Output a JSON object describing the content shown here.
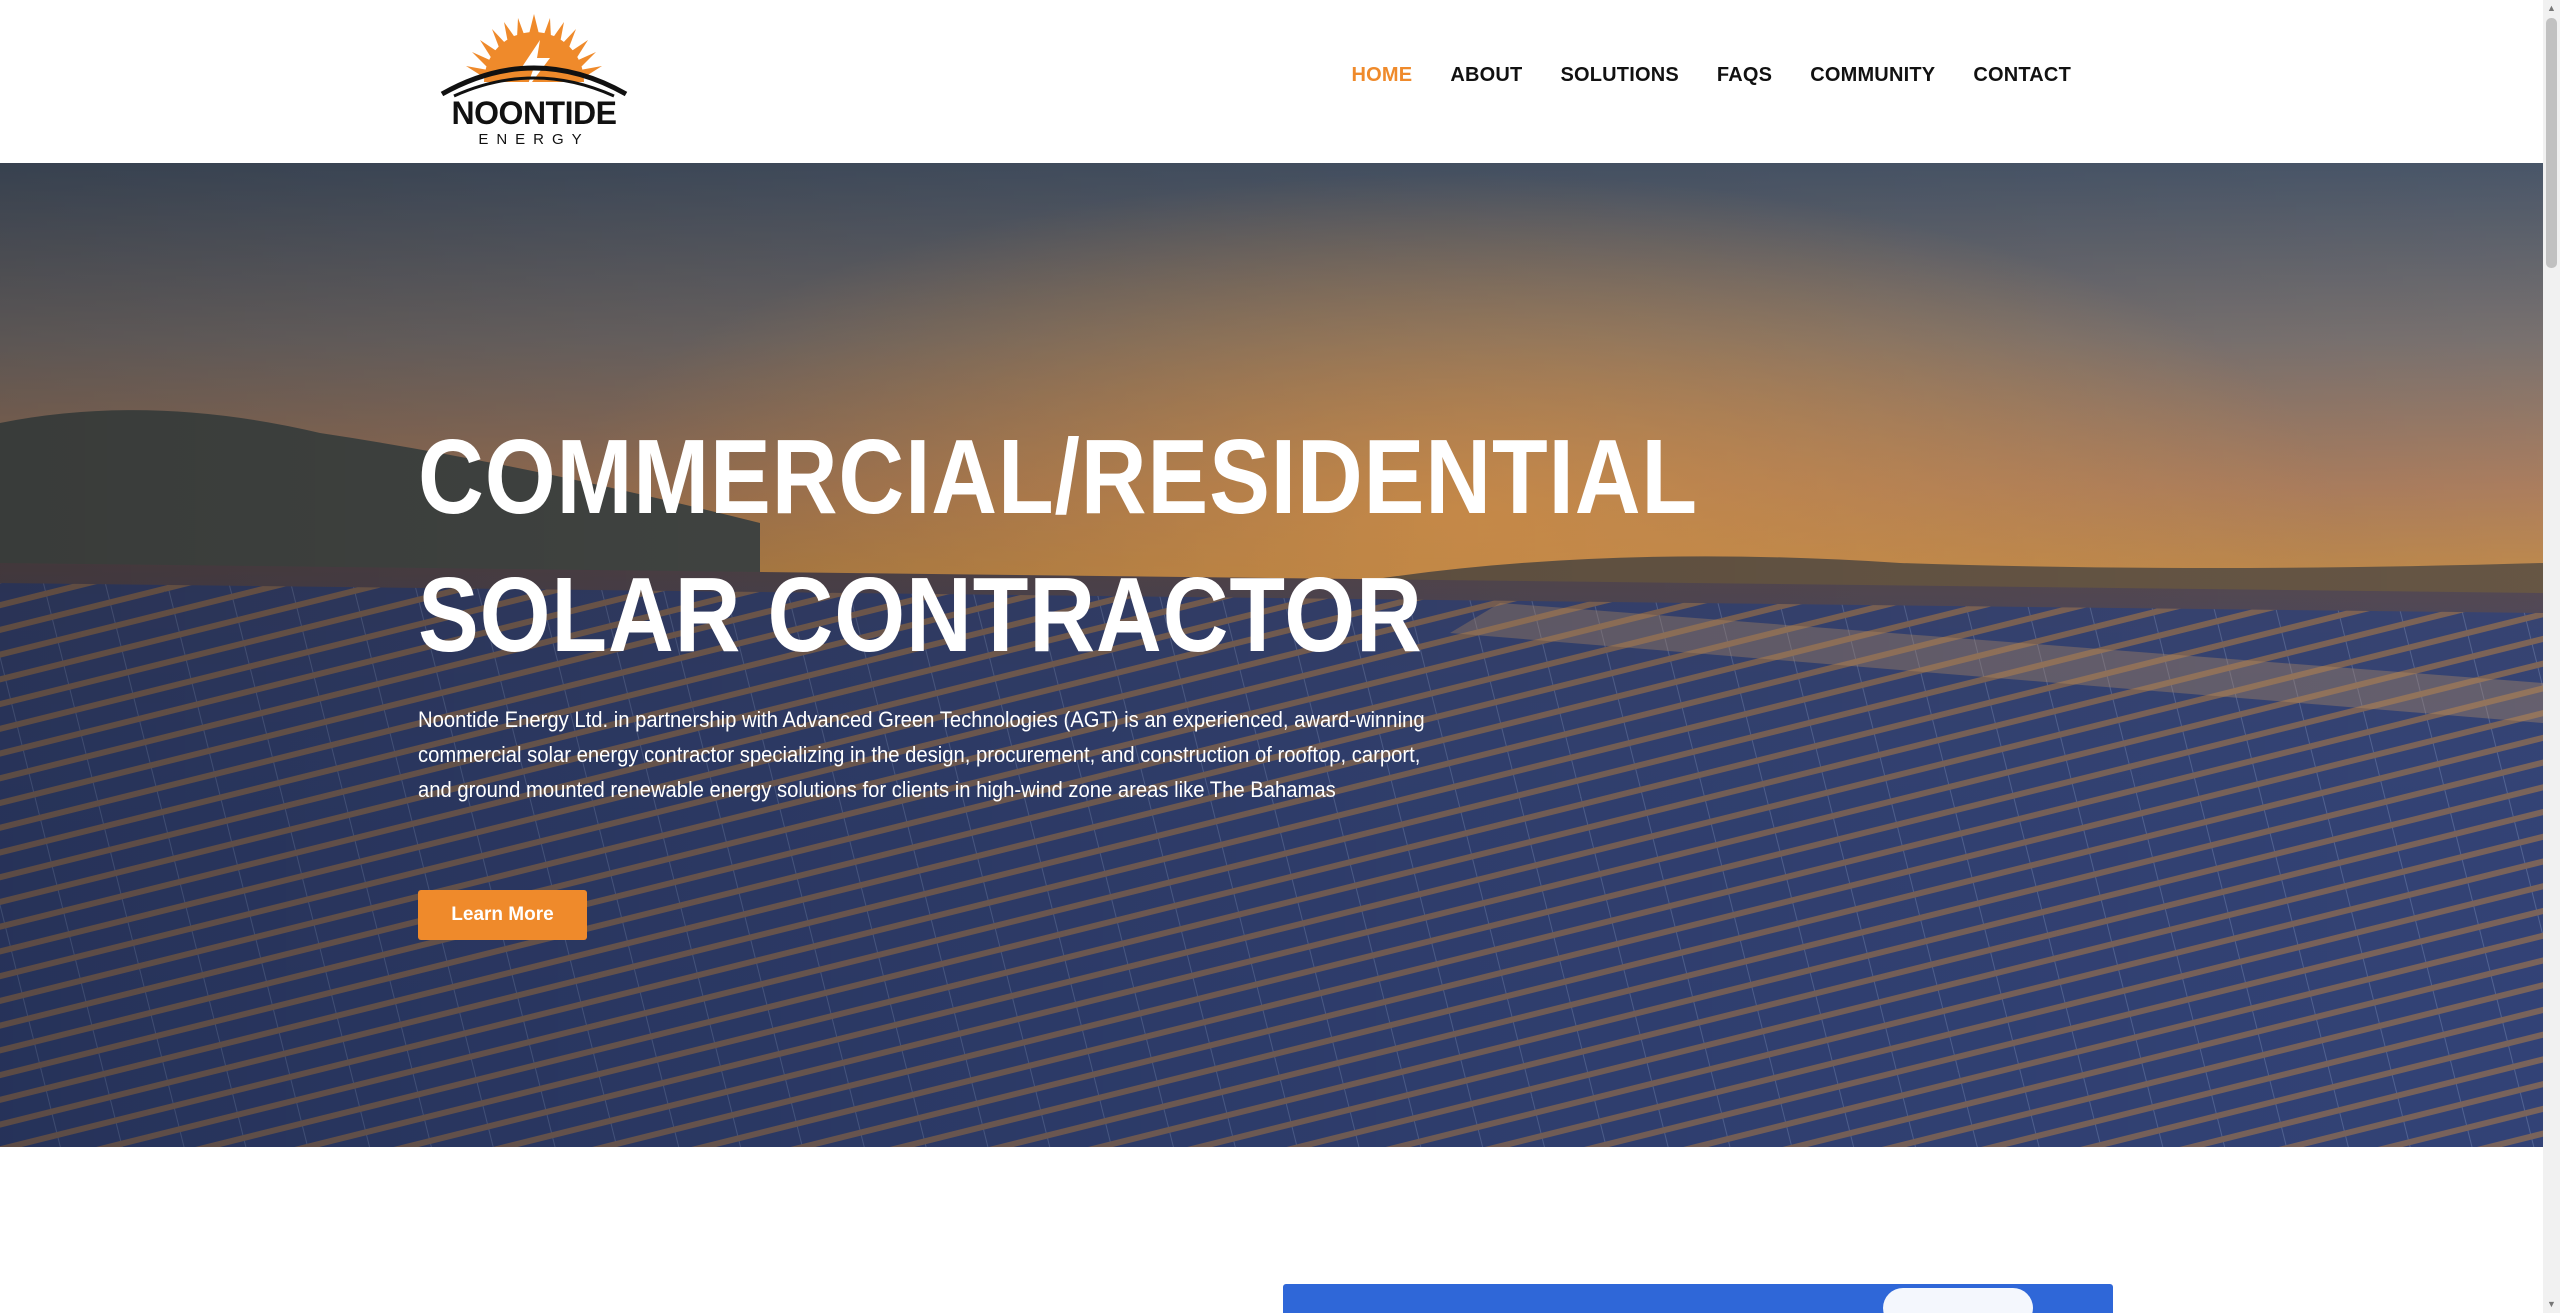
{
  "brand": {
    "name": "NOONTIDE",
    "sub": "ENERGY",
    "accent_color": "#ef8a2b"
  },
  "nav": {
    "items": [
      {
        "label": "HOME",
        "active": true
      },
      {
        "label": "ABOUT",
        "active": false
      },
      {
        "label": "SOLUTIONS",
        "active": false
      },
      {
        "label": "FAQS",
        "active": false
      },
      {
        "label": "COMMUNITY",
        "active": false
      },
      {
        "label": "CONTACT",
        "active": false
      }
    ]
  },
  "hero": {
    "title_line1": "COMMERCIAL/RESIDENTIAL",
    "title_line2": "SOLAR CONTRACTOR",
    "description": "Noontide Energy Ltd. in partnership with Advanced Green Technologies (AGT) is an experienced, award-winning commercial solar energy contractor specializing in the design, procurement, and construction of rooftop, carport, and ground mounted renewable energy solutions for clients in high-wind zone areas like The Bahamas",
    "button_label": "Learn More"
  },
  "scrollbar": {
    "up_icon": "▲",
    "down_icon": "▼"
  }
}
